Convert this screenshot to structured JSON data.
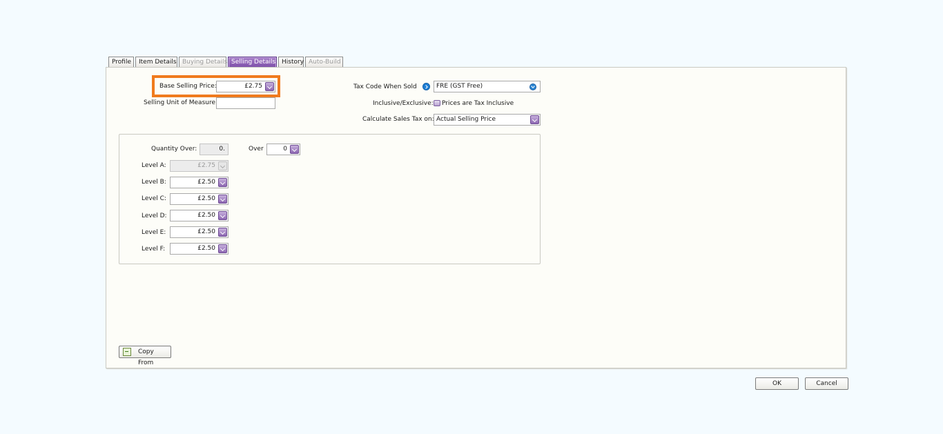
{
  "tabs": [
    {
      "label": "Profile",
      "state": "normal"
    },
    {
      "label": "Item Details",
      "state": "normal"
    },
    {
      "label": "Buying Details",
      "state": "disabled"
    },
    {
      "label": "Selling Details",
      "state": "active"
    },
    {
      "label": "History",
      "state": "normal"
    },
    {
      "label": "Auto-Build",
      "state": "disabled"
    }
  ],
  "selling": {
    "base_price_label": "Base Selling Price:",
    "base_price_value": "£2.75",
    "unit_label": "Selling Unit of Measure:",
    "unit_value": "",
    "tax_code_label": "Tax Code When Sold",
    "tax_code_value": "FRE (GST Free)",
    "inclusive_label": "Inclusive/Exclusive:",
    "inclusive_checkbox_label": "Prices are Tax Inclusive",
    "calc_tax_label": "Calculate Sales Tax on:",
    "calc_tax_value": "Actual Selling Price"
  },
  "pricing": {
    "quantity_over_label": "Quantity Over:",
    "quantity_over_value": "0.",
    "over_label": "Over",
    "over_value": "0",
    "levels": [
      {
        "label": "Level A:",
        "value": "£2.75",
        "disabled": true
      },
      {
        "label": "Level B:",
        "value": "£2.50",
        "disabled": false
      },
      {
        "label": "Level C:",
        "value": "£2.50",
        "disabled": false
      },
      {
        "label": "Level D:",
        "value": "£2.50",
        "disabled": false
      },
      {
        "label": "Level E:",
        "value": "£2.50",
        "disabled": false
      },
      {
        "label": "Level F:",
        "value": "£2.50",
        "disabled": false
      }
    ]
  },
  "buttons": {
    "copy_from": "Copy From",
    "ok": "OK",
    "cancel": "Cancel"
  },
  "colors": {
    "accent": "#7c4ea8",
    "highlight": "#f07b1e"
  }
}
